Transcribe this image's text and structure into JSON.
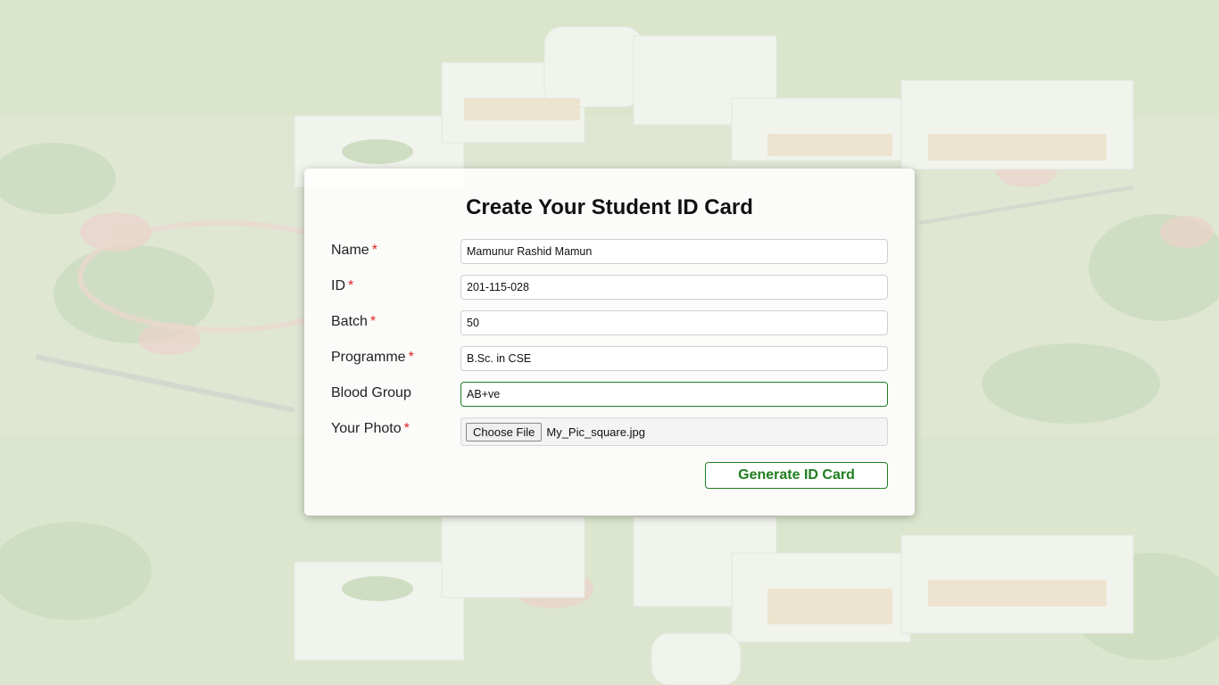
{
  "form": {
    "title": "Create Your Student ID Card",
    "required_mark": "*",
    "fields": [
      {
        "label": "Name",
        "required": true,
        "value": "Mamunur Rashid Mamun"
      },
      {
        "label": "ID",
        "required": true,
        "value": "201-115-028"
      },
      {
        "label": "Batch",
        "required": true,
        "value": "50"
      },
      {
        "label": "Programme",
        "required": true,
        "value": "B.Sc. in CSE"
      },
      {
        "label": "Blood Group",
        "required": false,
        "value": "AB+ve"
      }
    ],
    "photo": {
      "label": "Your Photo",
      "required": true,
      "button_label": "Choose File",
      "file_name": "My_Pic_square.jpg"
    },
    "submit_label": "Generate ID Card"
  },
  "colors": {
    "accent": "#1e7e1e",
    "required": "#e02424"
  }
}
